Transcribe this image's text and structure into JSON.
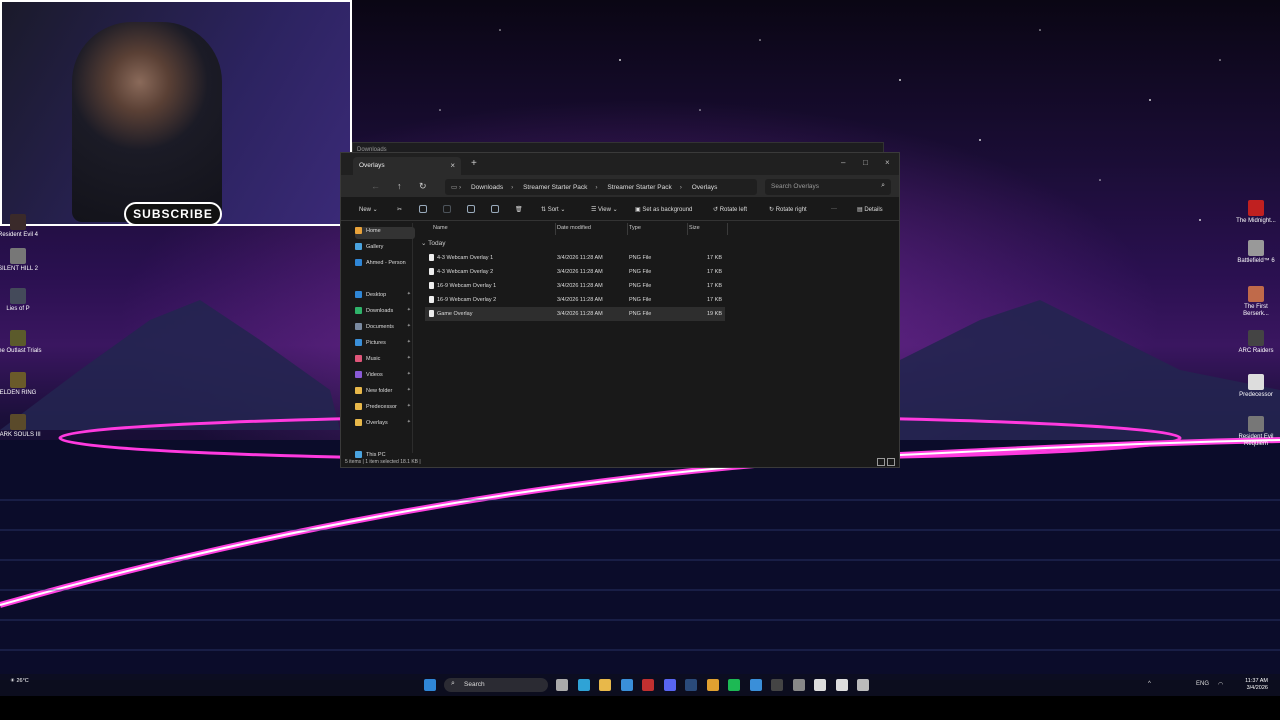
{
  "webcam": {
    "subscribe_label": "SUBSCRIBE"
  },
  "desktop_left_icons": [
    {
      "label": "Resident Evil 4",
      "color": "#3a2a2a"
    },
    {
      "label": "SILENT HILL 2",
      "color": "#777"
    },
    {
      "label": "Lies of P",
      "color": "#444a5a"
    },
    {
      "label": "The Outlast Trials",
      "color": "#5b5a2b"
    },
    {
      "label": "ELDEN RING",
      "color": "#6a5a2a"
    },
    {
      "label": "DARK SOULS III",
      "color": "#5a4a2a"
    }
  ],
  "desktop_right_icons": [
    {
      "label": "The Midnight...",
      "color": "#c02020"
    },
    {
      "label": "Battlefield™ 6",
      "color": "#999"
    },
    {
      "label": "The First Berserk...",
      "color": "#c06a4a"
    },
    {
      "label": "ARC Raiders",
      "color": "#444"
    },
    {
      "label": "Predecessor",
      "color": "#ddd"
    },
    {
      "label": "Resident Evil Requiem",
      "color": "#777"
    }
  ],
  "back_window": {
    "tab": "Downloads"
  },
  "explorer": {
    "tab_title": "Overlays",
    "breadcrumb": [
      "Downloads",
      "Streamer Starter Pack",
      "Streamer Starter Pack",
      "Overlays"
    ],
    "search_placeholder": "Search Overlays",
    "commands": {
      "new": "New",
      "sort": "Sort",
      "view": "View",
      "set_background": "Set as background",
      "rotate_left": "Rotate left",
      "rotate_right": "Rotate right",
      "more": "···",
      "details": "Details"
    },
    "nav": [
      {
        "label": "Home",
        "color": "#e8a23a",
        "selected": true
      },
      {
        "label": "Gallery",
        "color": "#4aa3df"
      },
      {
        "label": "Ahmed - Person",
        "color": "#2f86d6"
      },
      {
        "label": "Desktop",
        "color": "#2f86d6",
        "pinned": true
      },
      {
        "label": "Downloads",
        "color": "#2fb36a",
        "pinned": true
      },
      {
        "label": "Documents",
        "color": "#7a8aa0",
        "pinned": true
      },
      {
        "label": "Pictures",
        "color": "#3a8fd9",
        "pinned": true
      },
      {
        "label": "Music",
        "color": "#e0567a",
        "pinned": true
      },
      {
        "label": "Videos",
        "color": "#8a5ad6",
        "pinned": true
      },
      {
        "label": "New folder",
        "color": "#e8b84a",
        "pinned": true
      },
      {
        "label": "Predecessor",
        "color": "#e8b84a",
        "pinned": true
      },
      {
        "label": "Overlays",
        "color": "#e8b84a",
        "pinned": true
      },
      {
        "label": "This PC",
        "color": "#4aa3df"
      }
    ],
    "columns": {
      "name": "Name",
      "date": "Date modified",
      "type": "Type",
      "size": "Size"
    },
    "group": "Today",
    "files": [
      {
        "name": "4-3 Webcam Overlay 1",
        "date": "3/4/2026 11:28 AM",
        "type": "PNG File",
        "size": "17 KB"
      },
      {
        "name": "4-3 Webcam Overlay 2",
        "date": "3/4/2026 11:28 AM",
        "type": "PNG File",
        "size": "17 KB"
      },
      {
        "name": "16-9 Webcam Overlay 1",
        "date": "3/4/2026 11:28 AM",
        "type": "PNG File",
        "size": "17 KB"
      },
      {
        "name": "16-9 Webcam Overlay 2",
        "date": "3/4/2026 11:28 AM",
        "type": "PNG File",
        "size": "17 KB"
      },
      {
        "name": "Game Overlay",
        "date": "3/4/2026 11:28 AM",
        "type": "PNG File",
        "size": "19 KB",
        "selected": true
      }
    ],
    "status": "5 items  |  1 item selected  18.1 KB  |"
  },
  "taskbar": {
    "weather": "26°C",
    "search_placeholder": "Search",
    "lang": "ENG",
    "time": "11:37 AM",
    "date": "3/4/2026",
    "apps": [
      {
        "name": "start-icon",
        "color": "#2f86d6"
      },
      {
        "name": "task-view-icon",
        "color": "#aaa"
      },
      {
        "name": "edge-icon",
        "color": "#2fa3d6"
      },
      {
        "name": "file-explorer-icon",
        "color": "#e8b84a"
      },
      {
        "name": "store-icon",
        "color": "#3a8fd9"
      },
      {
        "name": "obs-icon",
        "color": "#c03030"
      },
      {
        "name": "discord-icon",
        "color": "#5865f2"
      },
      {
        "name": "steam-icon",
        "color": "#2a4a7a"
      },
      {
        "name": "chrome-icon",
        "color": "#e0a030"
      },
      {
        "name": "spotify-icon",
        "color": "#1db954"
      },
      {
        "name": "mail-icon",
        "color": "#3a8fd9"
      },
      {
        "name": "terminal-icon",
        "color": "#444"
      },
      {
        "name": "settings-icon",
        "color": "#888"
      },
      {
        "name": "app-icon",
        "color": "#ddd"
      },
      {
        "name": "capture-icon",
        "color": "#ddd"
      },
      {
        "name": "epic-icon",
        "color": "#bbb"
      }
    ]
  }
}
